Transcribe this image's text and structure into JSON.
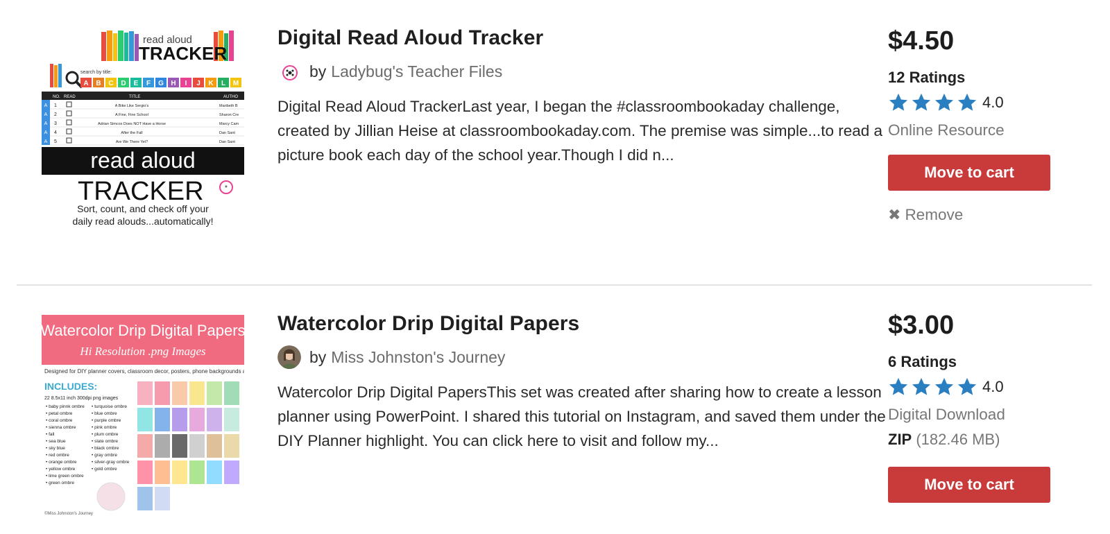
{
  "items": [
    {
      "title": "Digital Read Aloud Tracker",
      "by": "by",
      "seller": "Ladybug's Teacher Files",
      "description": "Digital Read Aloud TrackerLast year, I began the #classroombookaday challenge, created by Jillian Heise at classroombookaday.com. The premise was simple...to read a picture book each day of the school year.Though I did n...",
      "price": "$4.50",
      "ratings": "12 Ratings",
      "rating_value": "4.0",
      "resource_type": "Online Resource",
      "cart_label": "Move to cart",
      "remove_label": "Remove",
      "thumbnail": {
        "header": "read aloud",
        "header_big": "TRACKER",
        "search_label": "search by title:",
        "letters": [
          "A",
          "B",
          "C",
          "D",
          "E",
          "F",
          "G",
          "H",
          "I",
          "J",
          "K",
          "L",
          "M"
        ],
        "col_no": "NO.",
        "col_read": "READ",
        "col_title": "TITLE",
        "col_author": "AUTHO",
        "rows": [
          {
            "letter": "A",
            "no": "1",
            "title": "A Bike Like Sergio's",
            "author": "Maribeth B"
          },
          {
            "letter": "A",
            "no": "2",
            "title": "A Fine, Fine School",
            "author": "Sharon Cre"
          },
          {
            "letter": "A",
            "no": "3",
            "title": "Adrian Simcox Does NOT Have a Horse",
            "author": "Marcy Cam"
          },
          {
            "letter": "A",
            "no": "4",
            "title": "After the Fall",
            "author": "Dan Sant"
          },
          {
            "letter": "A",
            "no": "5",
            "title": "Are We There Yet?",
            "author": "Dan Sant"
          }
        ],
        "banner": "read aloud",
        "big": "TRACKER",
        "brand": "Ladybug's Teacher Files",
        "tagline1": "Sort, count, and check off your",
        "tagline2": "daily read alouds...automatically!"
      }
    },
    {
      "title": "Watercolor Drip Digital Papers",
      "by": "by",
      "seller": "Miss Johnston's Journey",
      "description": "Watercolor Drip Digital PapersThis set was created after sharing how to create a lesson planner using PowerPoint. I shared this tutorial on Instagram, and saved them under the DIY Planner highlight. You can click here to visit and follow my...",
      "price": "$3.00",
      "ratings": "6 Ratings",
      "rating_value": "4.0",
      "resource_type": "Digital Download",
      "file_type": "ZIP",
      "file_size": "(182.46 MB)",
      "cart_label": "Move to cart",
      "thumbnail": {
        "header1": "Watercolor Drip Digital Papers",
        "header2": "Hi Resolution .png Images",
        "intro": "Designed for DIY planner covers, classroom decor, posters, phone backgrounds and more",
        "includes": "INCLUDES:",
        "count": "22 8.5x11 inch 300dpi png images",
        "list_a": [
          "baby pinnk ombre",
          "petal ombre",
          "coral ombre",
          "sienna ombre",
          "fall",
          "sea blue",
          "sky blue",
          "red ombre",
          "orange ombre",
          "yellow ombre",
          "lime green ombre",
          "green ombre"
        ],
        "list_b": [
          "turquoise ombre",
          "blue ombre",
          "purple ombre",
          "pink ombre",
          "plum ombre",
          "slate ombre",
          "black ombre",
          "gray ombre",
          "silver-gray ombre",
          "gold ombre"
        ],
        "footer": "©Miss Johnston's Journey",
        "brand": "Miss Johnston's Journey"
      }
    }
  ],
  "colors": {
    "accent_red": "#c93a3a",
    "star_blue": "#2a7fc1",
    "muted": "#6b6b6b"
  }
}
